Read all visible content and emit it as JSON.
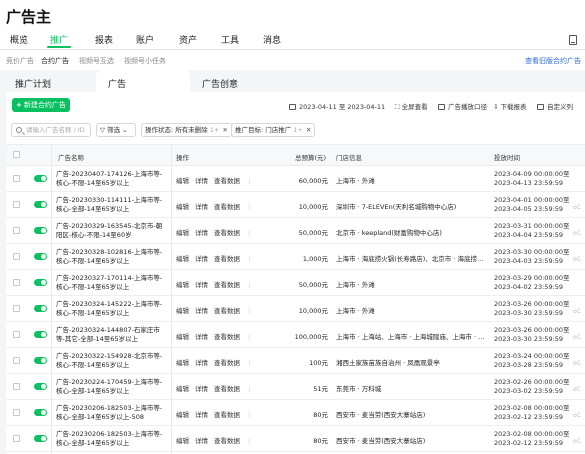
{
  "app": {
    "title": "广告主"
  },
  "nav_primary": [
    {
      "label": "概览"
    },
    {
      "label": "推广"
    },
    {
      "label": "报表"
    },
    {
      "label": "账户"
    },
    {
      "label": "资产"
    },
    {
      "label": "工具"
    },
    {
      "label": "消息"
    }
  ],
  "nav_primary_active": "推广",
  "nav_secondary": [
    {
      "label": "竞价广告"
    },
    {
      "label": "合约广告"
    },
    {
      "label": "视频号互选"
    },
    {
      "label": "视频号小任务"
    }
  ],
  "nav_secondary_link": "查看旧版合约广告",
  "tabs": [
    {
      "label": "推广计划"
    },
    {
      "label": "广告"
    },
    {
      "label": "广告创意"
    }
  ],
  "active_tab": "广告",
  "toolbar": {
    "new_button": "新建合约广告",
    "date_range": "2023-04-11 至 2023-04-11",
    "fullscreen": "全屏查看",
    "broadcast": "广告播放口径",
    "download": "下载报表",
    "custom_columns": "自定义列"
  },
  "filters": {
    "search_placeholder": "请输入广告名称 / ID",
    "filter_label": "筛选",
    "chip_status": "操作状态: 所有未删除",
    "chip_status_count": "1+",
    "chip_target": "推广目标: 门店推广",
    "chip_target_count": "1+"
  },
  "table": {
    "headers": {
      "name": "广告名称",
      "ops": "操作",
      "budget": "总预算(元)",
      "store": "门店信息",
      "time": "投放时间"
    },
    "ops_labels": {
      "edit": "编辑",
      "detail": "详情",
      "view": "查看数据",
      "more": "⋮"
    },
    "rows": [
      {
        "name": "广告-20230407-174126-上海市等-核心-不限-14至65岁以上",
        "budget": "60,000元",
        "store": "上海市 · 外滩",
        "time_start": "2023-04-09 00:00:00至",
        "time_end": "2023-04-13 23:59:59",
        "extra": ""
      },
      {
        "name": "广告-20230330-114111-上海市等-核心-全部-14至65岁以上",
        "budget": "10,000元",
        "store": "深圳市 · 7-ELEVEn(天利名城购物中心店)",
        "time_start": "2023-04-01 00:00:00至",
        "time_end": "2023-04-05 23:59:59",
        "extra": "oC"
      },
      {
        "name": "广告-20230329-163545-北京市-朝阳区-核心-不限-14至60岁",
        "budget": "50,000元",
        "store": "北京市 · keepland(财富购物中心店)",
        "time_start": "2023-03-31 00:00:00至",
        "time_end": "2023-04-04 23:59:59",
        "extra": "oC"
      },
      {
        "name": "广告-20230328-102816-上海市等-核心-不限-14至65岁以上",
        "budget": "1,000元",
        "store": "上海市 · 海底捞火锅(长寿路店)、北京市 · 海底捞火锅(...",
        "time_start": "2023-03-30 00:00:00至",
        "time_end": "2023-04-03 23:59:59",
        "extra": "oC"
      },
      {
        "name": "广告-20230327-170114-上海市等-核心-不限-14至65岁以上",
        "budget": "50,000元",
        "store": "上海市 · 外滩",
        "time_start": "2023-03-29 00:00:00至",
        "time_end": "2023-04-02 23:59:59",
        "extra": ""
      },
      {
        "name": "广告-20230324-145222-上海市等-核心-不限-14至65岁以上",
        "budget": "10,000元",
        "store": "上海市 · 外滩",
        "time_start": "2023-03-26 00:00:00至",
        "time_end": "2023-03-30 23:59:59",
        "extra": "oC"
      },
      {
        "name": "广告-20230324-144807-石家庄市等-其它-全部-14至65岁以上",
        "budget": "100,000元",
        "store": "上海市 · 上海站、上海市 · 上海城隍庙、上海市 · 上海...",
        "time_start": "2023-03-26 00:00:00至",
        "time_end": "2023-03-30 23:59:59",
        "extra": "oC"
      },
      {
        "name": "广告-20230322-154928-北京市等-核心-不限-14至65岁以上",
        "budget": "100元",
        "store": "湘西土家族苗族自治州 · 凤凰观景亭",
        "time_start": "2023-03-24 00:00:00至",
        "time_end": "2023-03-28 23:59:59",
        "extra": "oC"
      },
      {
        "name": "广告-20230224-170459-上海市等-核心-全部-14至65岁以上",
        "budget": "51元",
        "store": "东莞市 · 万科城",
        "time_start": "2023-02-26 00:00:00至",
        "time_end": "2023-03-02 23:59:59",
        "extra": "oC"
      },
      {
        "name": "广告-20230206-182503-上海市等-核心-全部-14至65岁以上-508",
        "budget": "80元",
        "store": "西安市 · 麦当劳(西安大寨站店)",
        "time_start": "2023-02-08 00:00:00至",
        "time_end": "2023-02-12 23:59:59",
        "extra": "oC"
      },
      {
        "name": "广告-20230206-182503-上海市等-核心-全部-14至65岁以上",
        "budget": "80元",
        "store": "西安市 · 麦当劳(西安大寨站店)",
        "time_start": "2023-02-08 00:00:00至",
        "time_end": "2023-02-12 23:59:59",
        "extra": "oC"
      }
    ]
  },
  "colors": {
    "accent": "#07c160",
    "link": "#2e6bd8"
  }
}
